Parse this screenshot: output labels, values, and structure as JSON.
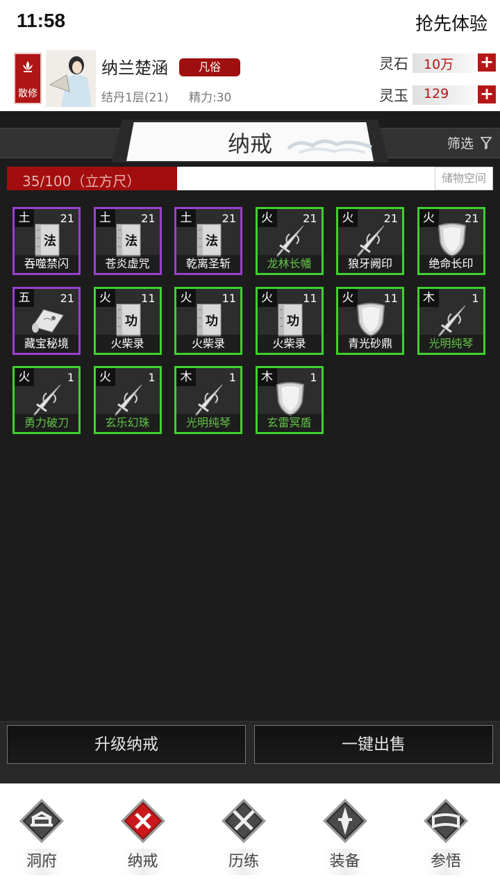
{
  "status": {
    "time": "11:58",
    "right_text": "抢先体验"
  },
  "player": {
    "badge": "散修",
    "name": "纳兰楚涵",
    "rank": "凡俗",
    "realm": "结丹1层(21)",
    "energy": "精力:30"
  },
  "resources": [
    {
      "label": "灵石",
      "value": "10万",
      "plus": "+"
    },
    {
      "label": "灵玉",
      "value": "129",
      "plus": "+"
    }
  ],
  "panel": {
    "title": "纳戒",
    "filter": "筛选",
    "capacity_text": "35/100（立方尺）",
    "capacity_fraction": 0.35,
    "storage_button": "储物空间"
  },
  "items": [
    {
      "element": "土",
      "count": "21",
      "name": "吞噬禁闪",
      "rarity": "purple",
      "icon": "scroll-fa-icon",
      "glyph": "法",
      "name_color": "white"
    },
    {
      "element": "土",
      "count": "21",
      "name": "苍炎虚咒",
      "rarity": "purple",
      "icon": "scroll-fa-icon",
      "glyph": "法",
      "name_color": "white"
    },
    {
      "element": "土",
      "count": "21",
      "name": "乾离圣斩",
      "rarity": "purple",
      "icon": "scroll-fa-icon",
      "glyph": "法",
      "name_color": "white"
    },
    {
      "element": "火",
      "count": "21",
      "name": "龙林长幡",
      "rarity": "green",
      "icon": "sword-icon",
      "name_color": "green"
    },
    {
      "element": "火",
      "count": "21",
      "name": "狼牙阙印",
      "rarity": "green",
      "icon": "sword-icon",
      "name_color": "white"
    },
    {
      "element": "火",
      "count": "21",
      "name": "绝命长印",
      "rarity": "green",
      "icon": "shield-icon",
      "name_color": "white"
    },
    {
      "element": "五",
      "count": "21",
      "name": "藏宝秘境",
      "rarity": "purple",
      "icon": "map-scroll-icon",
      "name_color": "white"
    },
    {
      "element": "火",
      "count": "11",
      "name": "火柴录",
      "rarity": "green",
      "icon": "scroll-gong-icon",
      "glyph": "功",
      "name_color": "white"
    },
    {
      "element": "火",
      "count": "11",
      "name": "火柴录",
      "rarity": "green",
      "icon": "scroll-gong-icon",
      "glyph": "功",
      "name_color": "white"
    },
    {
      "element": "火",
      "count": "11",
      "name": "火柴录",
      "rarity": "green",
      "icon": "scroll-gong-icon",
      "glyph": "功",
      "name_color": "white"
    },
    {
      "element": "火",
      "count": "11",
      "name": "青光砂鼎",
      "rarity": "green",
      "icon": "shield-icon",
      "name_color": "white"
    },
    {
      "element": "木",
      "count": "1",
      "name": "光明纯琴",
      "rarity": "green",
      "icon": "sword-icon",
      "name_color": "green"
    },
    {
      "element": "火",
      "count": "1",
      "name": "勇力破刀",
      "rarity": "green",
      "icon": "sword-icon",
      "name_color": "green"
    },
    {
      "element": "火",
      "count": "1",
      "name": "玄乐幻珠",
      "rarity": "green",
      "icon": "sword-icon",
      "name_color": "green"
    },
    {
      "element": "木",
      "count": "1",
      "name": "光明纯琴",
      "rarity": "green",
      "icon": "sword-icon",
      "name_color": "green"
    },
    {
      "element": "木",
      "count": "1",
      "name": "玄雷冥盾",
      "rarity": "green",
      "icon": "shield-icon",
      "name_color": "green"
    }
  ],
  "actions": {
    "upgrade": "升级纳戒",
    "sell_all": "一键出售"
  },
  "nav": [
    {
      "label": "洞府",
      "icon": "gate-icon",
      "active": false
    },
    {
      "label": "纳戒",
      "icon": "close-icon",
      "active": true
    },
    {
      "label": "历练",
      "icon": "crossed-swords-icon",
      "active": false
    },
    {
      "label": "装备",
      "icon": "blade-icon",
      "active": false
    },
    {
      "label": "参悟",
      "icon": "book-icon",
      "active": false
    }
  ],
  "colors": {
    "accent_red": "#a30d0d",
    "purple_border": "#9a40cf",
    "green_border": "#3fd12f",
    "green_text": "#62c246"
  }
}
